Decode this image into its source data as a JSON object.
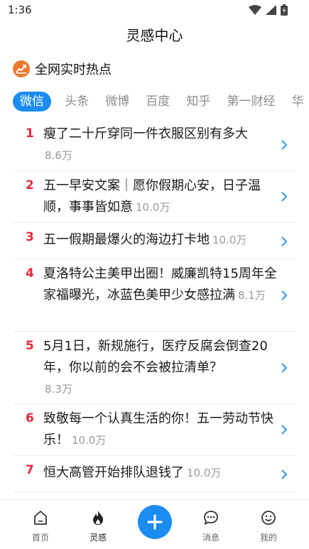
{
  "status": {
    "time": "1:36"
  },
  "header": {
    "title": "灵感中心"
  },
  "section": {
    "title": "全网实时热点",
    "icon": "trending-chart-icon"
  },
  "tabs": [
    {
      "label": "微信",
      "active": true
    },
    {
      "label": "头条",
      "active": false
    },
    {
      "label": "微博",
      "active": false
    },
    {
      "label": "百度",
      "active": false
    },
    {
      "label": "知乎",
      "active": false
    },
    {
      "label": "第一财经",
      "active": false
    },
    {
      "label": "华",
      "active": false
    }
  ],
  "hot_list": [
    {
      "rank": "1",
      "title": "瘦了二十斤穿同一件衣服区别有多大",
      "heat": "8.6万"
    },
    {
      "rank": "2",
      "title": "五一早安文案｜愿你假期心安，日子温顺，事事皆如意",
      "heat": "10.0万"
    },
    {
      "rank": "3",
      "title": "五一假期最爆火的海边打卡地",
      "heat": "10.0万"
    },
    {
      "rank": "4",
      "title": "夏洛特公主美甲出圈！威廉凯特15周年全家福曝光，冰蓝色美甲少女感拉满",
      "heat": "8.1万"
    },
    {
      "rank": "5",
      "title": "5月1日，新规施行，医疗反腐会倒查20年，你以前的会不会被拉清单？",
      "heat": "8.3万"
    },
    {
      "rank": "6",
      "title": "致敬每一个认真生活的你！五一劳动节快乐！",
      "heat": "10.0万"
    },
    {
      "rank": "7",
      "title": "恒大高管开始排队退钱了",
      "heat": "10.0万"
    }
  ],
  "nav": {
    "home": "首页",
    "inspiration": "灵感",
    "messages": "消息",
    "mine": "我的"
  },
  "colors": {
    "accent": "#1b8cf0",
    "rank": "#e6283c",
    "heat": "#9a9a9a"
  }
}
